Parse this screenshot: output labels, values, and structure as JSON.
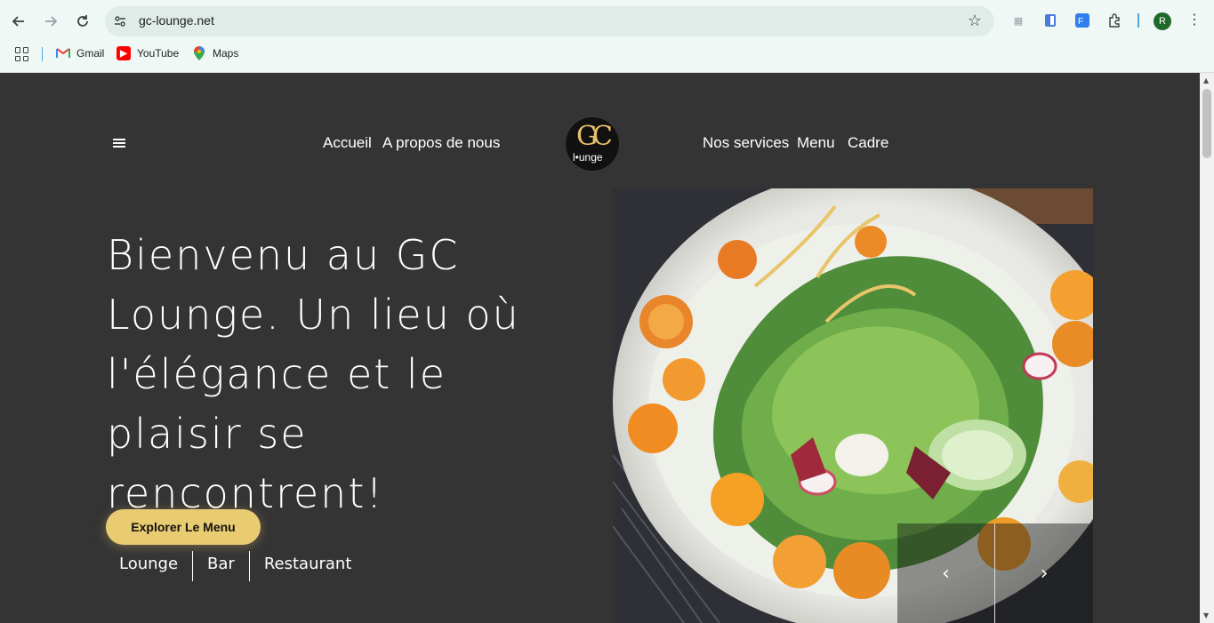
{
  "browser": {
    "url": "gc-lounge.net",
    "profile_initial": "R",
    "bookmarks": [
      {
        "label": "Gmail",
        "icon": "gmail-icon"
      },
      {
        "label": "YouTube",
        "icon": "youtube-icon"
      },
      {
        "label": "Maps",
        "icon": "maps-icon"
      }
    ]
  },
  "nav": {
    "left": [
      "Accueil",
      "A propos de nous"
    ],
    "right": [
      "Nos services",
      "Menu",
      "Cadre"
    ],
    "logo_text": "GC",
    "logo_sub": "l•unge"
  },
  "hero": {
    "title": "Bienvenu au GC Lounge. Un lieu où l'élégance et le plaisir se rencontrent!",
    "cta_label": "Explorer Le Menu",
    "tags": [
      "Lounge",
      "Bar",
      "Restaurant"
    ]
  },
  "carousel": {
    "prev_icon": "chevron-left-icon",
    "next_icon": "chevron-right-icon"
  },
  "colors": {
    "page_bg": "#353434",
    "accent": "#e9cb72",
    "chrome_bg": "#f0f8f6"
  }
}
